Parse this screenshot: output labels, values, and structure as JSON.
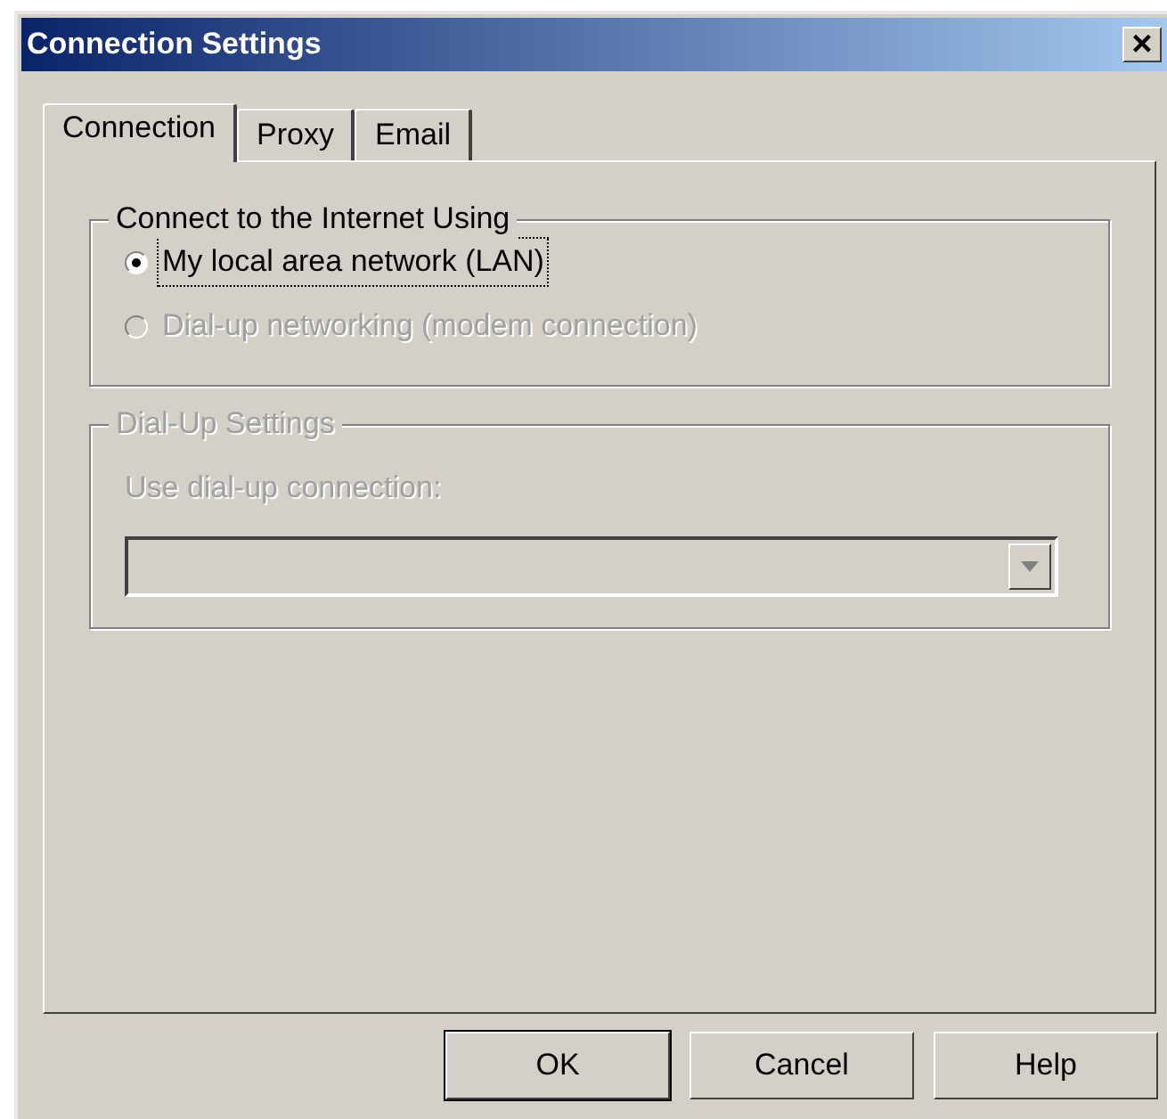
{
  "window": {
    "title": "Connection Settings",
    "close": "×"
  },
  "tabs": [
    {
      "label": "Connection",
      "selected": true
    },
    {
      "label": "Proxy",
      "selected": false
    },
    {
      "label": "Email",
      "selected": false
    }
  ],
  "connect_group": {
    "title": "Connect to the Internet Using",
    "disabled": false,
    "options": [
      {
        "label": "My local area network (LAN)",
        "selected": true,
        "disabled": false,
        "focused": true
      },
      {
        "label": "Dial-up networking (modem connection)",
        "selected": false,
        "disabled": true,
        "focused": false
      }
    ]
  },
  "dialup_group": {
    "title": "Dial-Up Settings",
    "disabled": true,
    "field_label": "Use dial-up connection:",
    "dropdown": {
      "disabled": true
    }
  },
  "buttons": [
    {
      "label": "OK",
      "default": true
    },
    {
      "label": "Cancel",
      "default": false
    },
    {
      "label": "Help",
      "default": false
    }
  ]
}
